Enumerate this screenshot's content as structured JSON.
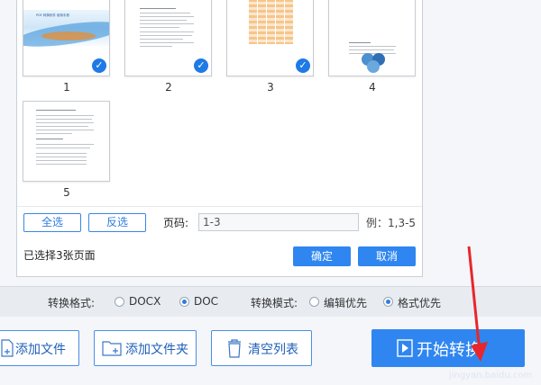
{
  "pages": [
    {
      "label": "1",
      "selected": true
    },
    {
      "label": "2",
      "selected": true
    },
    {
      "label": "3",
      "selected": true
    },
    {
      "label": "4",
      "selected": false
    },
    {
      "label": "5",
      "selected": false
    }
  ],
  "thumb_page1_caption": "PDF 转换软件 使用手册",
  "controls": {
    "select_all": "全选",
    "invert": "反选",
    "page_label": "页码:",
    "page_value": "1-3",
    "example": "例：1,3-5",
    "selected_status": "已选择3张页面",
    "ok": "确定",
    "cancel": "取消"
  },
  "format_bar": {
    "format_label": "转换格式:",
    "format_options": [
      {
        "label": "DOCX",
        "on": false
      },
      {
        "label": "DOC",
        "on": true
      }
    ],
    "mode_label": "转换模式:",
    "mode_options": [
      {
        "label": "编辑优先",
        "on": false
      },
      {
        "label": "格式优先",
        "on": true
      }
    ]
  },
  "toolbar": {
    "add_file": "添加文件",
    "add_folder": "添加文件夹",
    "clear_list": "清空列表",
    "start": "开始转换"
  },
  "watermark": "jingyan.baidu.com",
  "colors": {
    "accent": "#2f86f0",
    "annotation_arrow": "#e8262b"
  }
}
